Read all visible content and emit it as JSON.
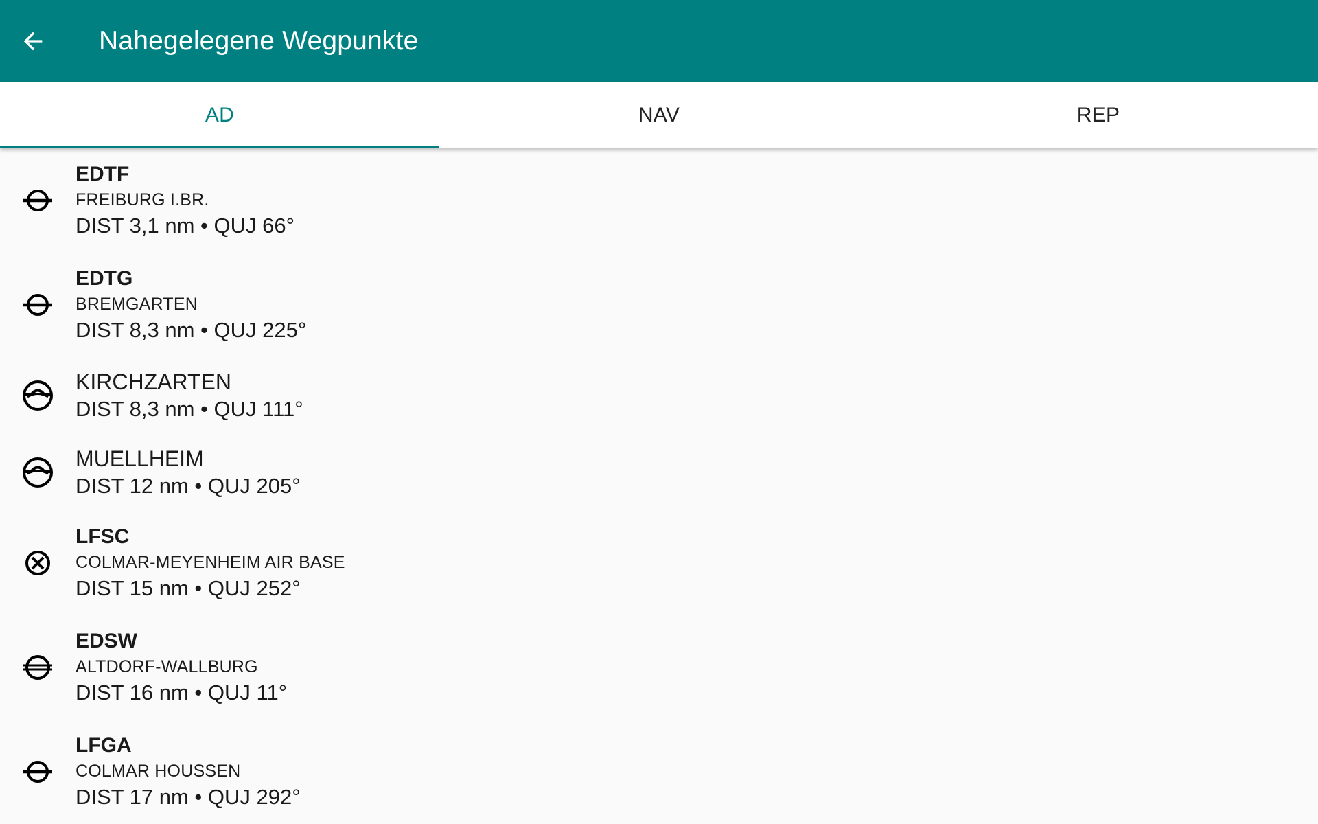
{
  "appbar": {
    "title": "Nahegelegene Wegpunkte",
    "back_icon": "arrow-back-icon",
    "background_color": "#008080"
  },
  "tabs": [
    {
      "label": "AD",
      "active": true
    },
    {
      "label": "NAV",
      "active": false
    },
    {
      "label": "REP",
      "active": false
    }
  ],
  "accent_color": "#008080",
  "waypoints": [
    {
      "code": "EDTF",
      "name": "FREIBURG I.BR.",
      "info": "DIST 3,1 nm • QUJ 66°",
      "icon": "civil-airfield-icon"
    },
    {
      "code": "EDTG",
      "name": "BREMGARTEN",
      "info": "DIST 8,3 nm • QUJ 225°",
      "icon": "civil-airfield-icon"
    },
    {
      "code": "",
      "name": "KIRCHZARTEN",
      "info": "DIST 8,3 nm • QUJ 111°",
      "icon": "glider-site-icon"
    },
    {
      "code": "",
      "name": "MUELLHEIM",
      "info": "DIST 12 nm • QUJ 205°",
      "icon": "glider-site-icon"
    },
    {
      "code": "LFSC",
      "name": "COLMAR-MEYENHEIM AIR BASE",
      "info": "DIST 15 nm • QUJ 252°",
      "icon": "military-airfield-icon"
    },
    {
      "code": "EDSW",
      "name": "ALTDORF-WALLBURG",
      "info": "DIST 16 nm • QUJ 11°",
      "icon": "small-airfield-icon"
    },
    {
      "code": "LFGA",
      "name": "COLMAR HOUSSEN",
      "info": "DIST 17 nm • QUJ 292°",
      "icon": "civil-airfield-icon"
    }
  ]
}
